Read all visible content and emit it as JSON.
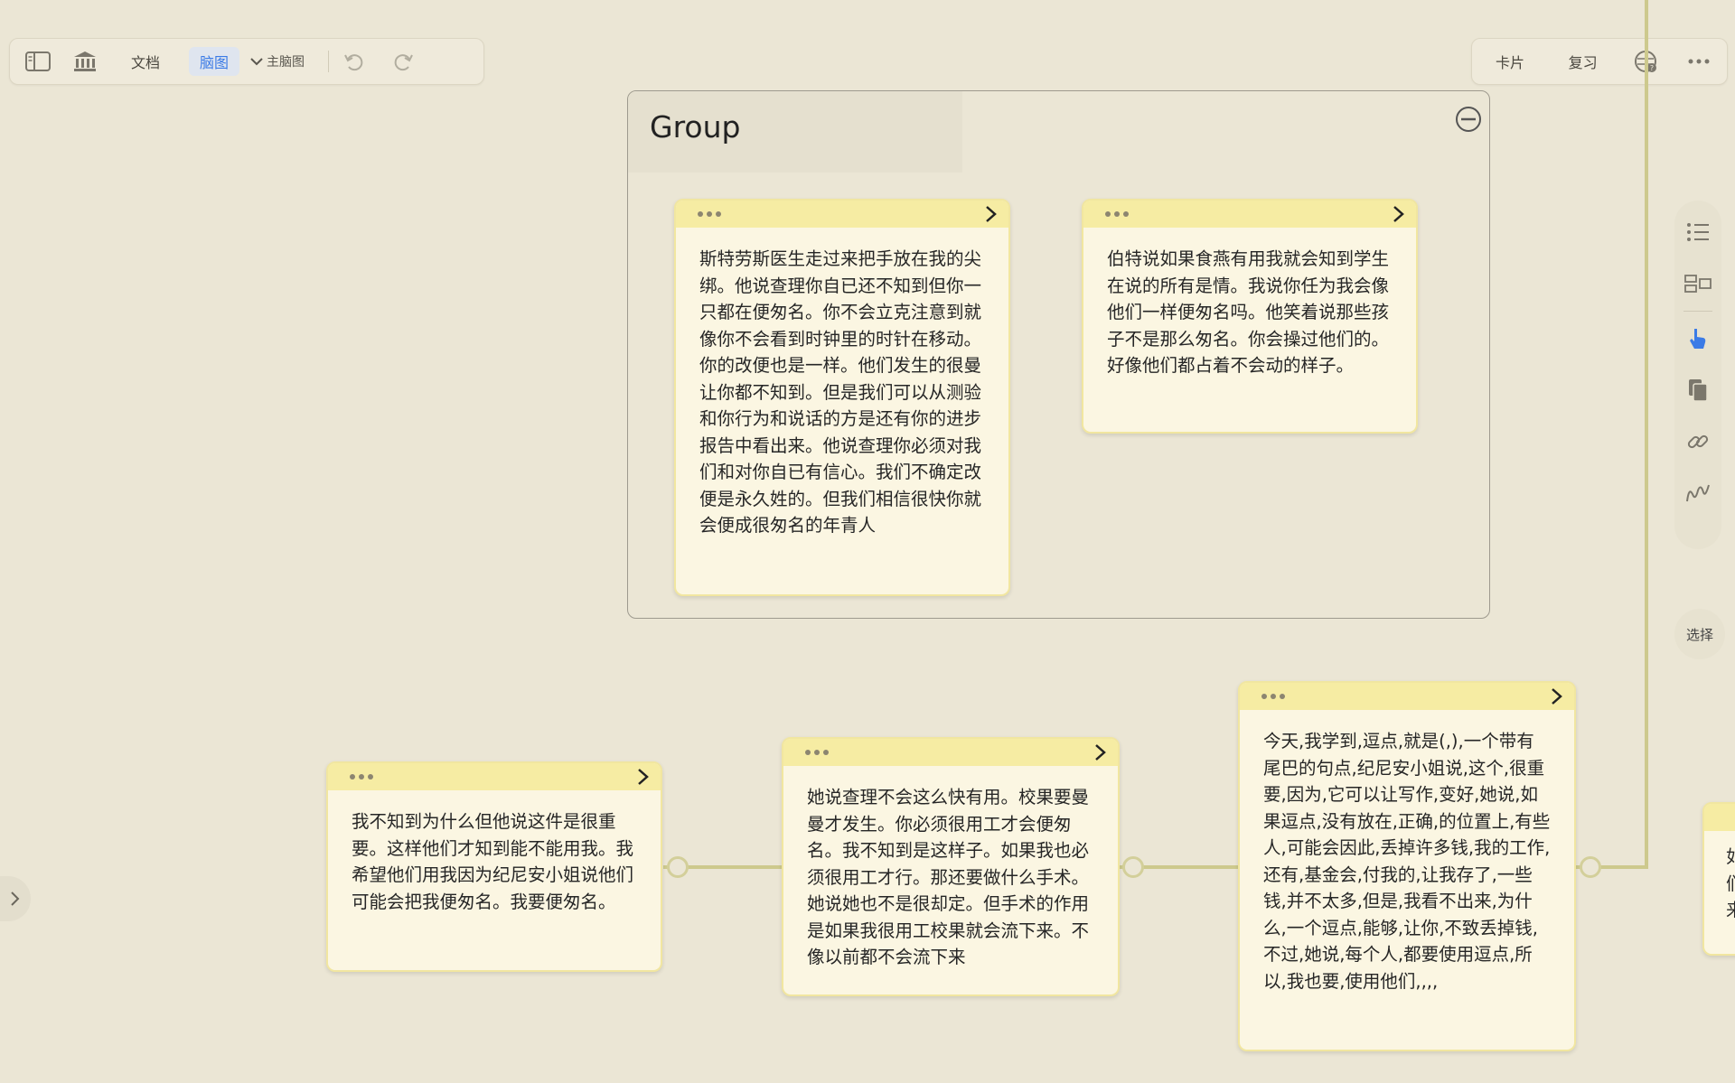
{
  "toolbar": {
    "doc_label": "文档",
    "mindmap_label": "脑图",
    "main_mindmap_label": "主脑图"
  },
  "right_toolbar": {
    "cards_label": "卡片",
    "review_label": "复习"
  },
  "group": {
    "title": "Group"
  },
  "cards": [
    {
      "text": "斯特劳斯医生走过来把手放在我的尖绑。他说查理你自已还不知到但你一只都在便匆名。你不会立克注意到就像你不会看到时钟里的时针在移动。你的改便也是一样。他们发生的很曼让你都不知到。但是我们可以从测验和你行为和说话的方是还有你的进步报告中看出来。他说查理你必须对我们和对你自已有信心。我们不确定改便是永久姓的。但我们相信很快你就会便成很匆名的年青人"
    },
    {
      "text": "伯特说如果食燕有用我就会知到学生在说的所有是情。我说你任为我会像他们一样便匆名吗。他笑着说那些孩子不是那么匆名。你会操过他们的。好像他们都占着不会动的样子。"
    },
    {
      "text": "我不知到为什么但他说这件是很重要。这样他们才知到能不能用我。我希望他们用我因为纪尼安小姐说他们可能会把我便匆名。我要便匆名。"
    },
    {
      "text": "她说查理不会这么快有用。校果要曼曼才发生。你必须很用工才会便匆名。我不知到是这样子。如果我也必须很用工才行。那还要做什么手术。她说她也不是很却定。但手术的作用是如果我很用工校果就会流下来。不像以前都不会流下来"
    },
    {
      "text": "今天,我学到,逗点,就是(,),一个带有尾巴的句点,纪尼安小姐说,这个,很重要,因为,它可以让写作,变好,她说,如果逗点,没有放在,正确,的位置上,有些人,可能会因此,丢掉许多钱,我的工作,还有,基金会,付我的,让我存了,一些钱,并不太多,但是,我看不出来,为什么,一个逗点,能够,让你,不致丢掉钱,不过,她说,每个人,都要使用逗点,所以,我也要,使用他们,,,,"
    }
  ],
  "partial_card": {
    "lines": [
      "如",
      "们",
      "来"
    ]
  },
  "sidebar": {
    "select_label": "选择"
  },
  "colors": {
    "background": "#ebe6d5",
    "card_header": "#f6eca3",
    "card_body": "#fbf6e2",
    "connector": "#cdc98d",
    "accent": "#3b7be6"
  }
}
